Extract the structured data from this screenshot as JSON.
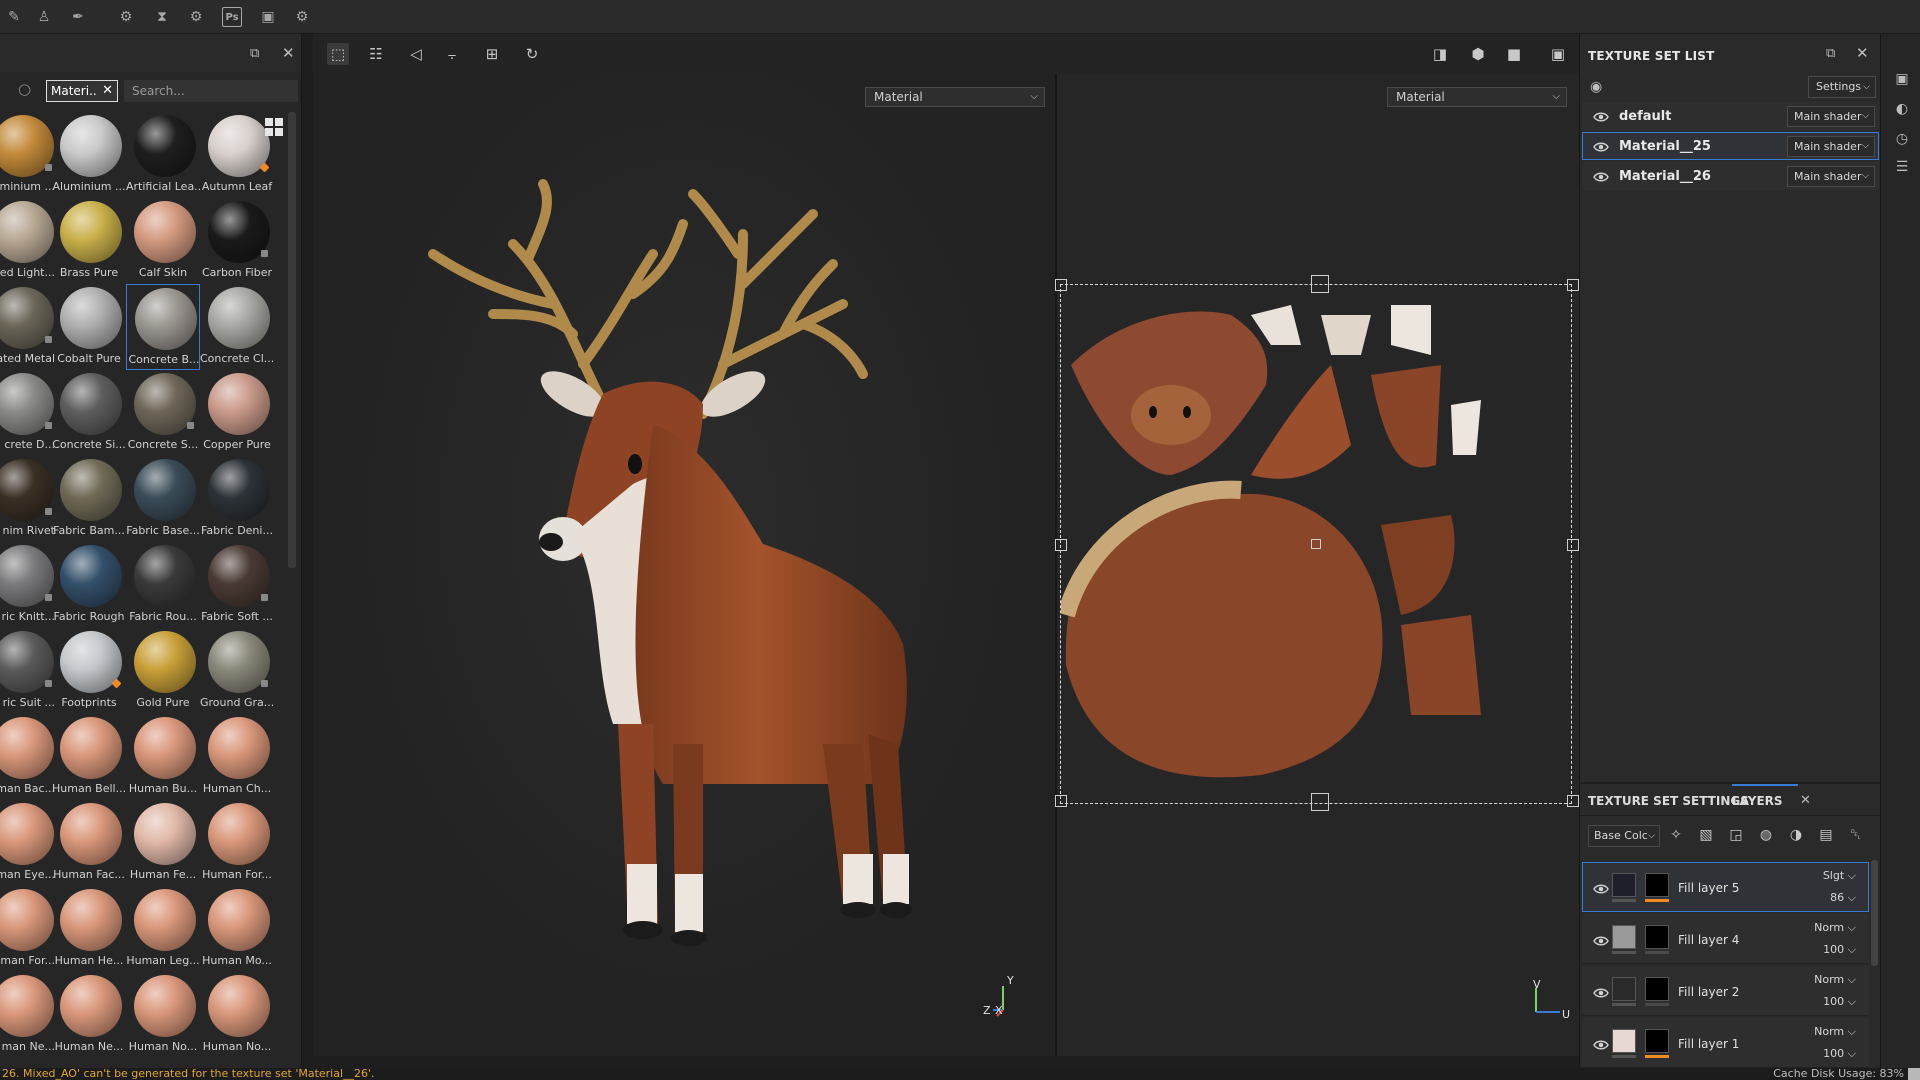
{
  "shelf": {
    "filter_tag": "Materi..",
    "search_placeholder": "Search...",
    "materials": [
      {
        "label": "minium ...",
        "color": "#c38a3a",
        "badge": "gray"
      },
      {
        "label": "Aluminium ...",
        "color": "#c9c9c9",
        "badge": ""
      },
      {
        "label": "Artificial Lea...",
        "color": "#1e1e1e",
        "badge": ""
      },
      {
        "label": "Autumn Leaf",
        "color": "#d8d0cc",
        "badge": "orange"
      },
      {
        "label": "ed Light...",
        "color": "#b8a894",
        "badge": ""
      },
      {
        "label": "Brass Pure",
        "color": "#c9b04a",
        "badge": ""
      },
      {
        "label": "Calf Skin",
        "color": "#d49a80",
        "badge": ""
      },
      {
        "label": "Carbon Fiber",
        "color": "#1a1a1a",
        "badge": "gray"
      },
      {
        "label": "ated Metal",
        "color": "#6b6658",
        "badge": "gray"
      },
      {
        "label": "Cobalt Pure",
        "color": "#b0b0b0",
        "badge": ""
      },
      {
        "label": "Concrete B...",
        "color": "#9a9690",
        "badge": "",
        "selected": true
      },
      {
        "label": "Concrete Cl...",
        "color": "#a8a8a4",
        "badge": ""
      },
      {
        "label": "crete D...",
        "color": "#8a8a88",
        "badge": "gray"
      },
      {
        "label": "Concrete Si...",
        "color": "#5e5e5e",
        "badge": ""
      },
      {
        "label": "Concrete S...",
        "color": "#6e6658",
        "badge": "gray"
      },
      {
        "label": "Copper Pure",
        "color": "#c99a8a",
        "badge": ""
      },
      {
        "label": "nim Rivet",
        "color": "#3a3024",
        "badge": "gray"
      },
      {
        "label": "Fabric Bam...",
        "color": "#706a56",
        "badge": ""
      },
      {
        "label": "Fabric Base...",
        "color": "#3a4c58",
        "badge": ""
      },
      {
        "label": "Fabric Deni...",
        "color": "#2c3238",
        "badge": ""
      },
      {
        "label": "ric Knitt...",
        "color": "#7a7a7c",
        "badge": "gray"
      },
      {
        "label": "Fabric Rough",
        "color": "#34506a",
        "badge": ""
      },
      {
        "label": "Fabric Rou...",
        "color": "#3a3a3a",
        "badge": ""
      },
      {
        "label": "Fabric Soft ...",
        "color": "#4a3a34",
        "badge": "gray"
      },
      {
        "label": "ric Suit ...",
        "color": "#5a5a5a",
        "badge": "gray"
      },
      {
        "label": "Footprints",
        "color": "#c4c8cc",
        "badge": "orange"
      },
      {
        "label": "Gold Pure",
        "color": "#c8a038",
        "badge": ""
      },
      {
        "label": "Ground Gra...",
        "color": "#8a887a",
        "badge": "gray"
      },
      {
        "label": "man Bac...",
        "color": "#d9977a",
        "badge": ""
      },
      {
        "label": "Human Bell...",
        "color": "#d9977a",
        "badge": ""
      },
      {
        "label": "Human Bu...",
        "color": "#d9977a",
        "badge": ""
      },
      {
        "label": "Human Ch...",
        "color": "#d9977a",
        "badge": ""
      },
      {
        "label": "man Eye...",
        "color": "#d9977a",
        "badge": ""
      },
      {
        "label": "Human Fac...",
        "color": "#d9977a",
        "badge": ""
      },
      {
        "label": "Human Fe...",
        "color": "#e0b8a8",
        "badge": ""
      },
      {
        "label": "Human For...",
        "color": "#d9977a",
        "badge": ""
      },
      {
        "label": "man For...",
        "color": "#d9977a",
        "badge": ""
      },
      {
        "label": "Human He...",
        "color": "#d9977a",
        "badge": ""
      },
      {
        "label": "Human Leg...",
        "color": "#d9977a",
        "badge": ""
      },
      {
        "label": "Human Mo...",
        "color": "#d9977a",
        "badge": ""
      },
      {
        "label": "man Ne...",
        "color": "#d9977a",
        "badge": ""
      },
      {
        "label": "Human Ne...",
        "color": "#d9977a",
        "badge": ""
      },
      {
        "label": "Human No...",
        "color": "#d9977a",
        "badge": ""
      },
      {
        "label": "Human No...",
        "color": "#d9977a",
        "badge": ""
      }
    ]
  },
  "viewport": {
    "left_channel": "Material",
    "right_channel": "Material",
    "axis_3d": {
      "y": "Y",
      "z": "Z",
      "x": "X"
    },
    "axis_uv": {
      "v": "V",
      "u": "U"
    }
  },
  "texture_set_list": {
    "title": "TEXTURE SET LIST",
    "settings_label": "Settings",
    "sets": [
      {
        "name": "default",
        "shader": "Main shader",
        "active": false
      },
      {
        "name": "Material__25",
        "shader": "Main shader",
        "active": true
      },
      {
        "name": "Material__26",
        "shader": "Main shader",
        "active": false
      }
    ]
  },
  "layers_panel": {
    "tab_settings": "TEXTURE SET SETTINGS",
    "tab_layers": "LAYERS",
    "channel": "Base Colc",
    "layers": [
      {
        "name": "Fill layer 5",
        "blend": "Slgt",
        "opacity": "86",
        "active": true,
        "swatch": "#1e1e2a",
        "bar": "#f08a22"
      },
      {
        "name": "Fill layer 4",
        "blend": "Norm",
        "opacity": "100",
        "active": false,
        "swatch": "#9a9a9a",
        "bar": "#4a4a4a"
      },
      {
        "name": "Fill layer 2",
        "blend": "Norm",
        "opacity": "100",
        "active": false,
        "swatch": "#2a2a2a",
        "bar": "#4a4a4a"
      },
      {
        "name": "Fill layer 1",
        "blend": "Norm",
        "opacity": "100",
        "active": false,
        "swatch": "#e8d8d4",
        "bar": "#f08a22"
      }
    ]
  },
  "status": {
    "message": "26. Mixed_AO' can't be generated for the texture set 'Material__26'.",
    "cache": "Cache Disk Usage:   83%"
  },
  "colors": {
    "accent": "#3a7bd5",
    "warning": "#e2a72e",
    "orange": "#f08a22"
  }
}
